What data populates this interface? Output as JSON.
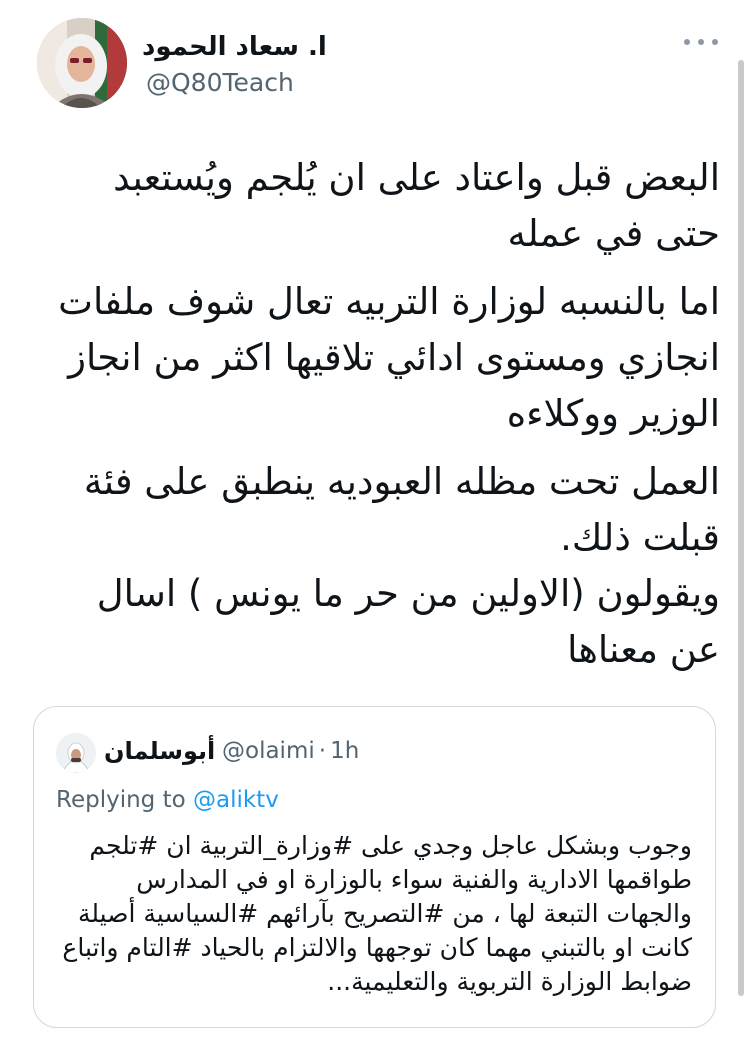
{
  "author": {
    "display_name": "ا. سعاد الحمود",
    "handle": "@Q80Teach"
  },
  "more_icon": "more-horizontal-icon",
  "tweet": {
    "paragraphs": [
      "البعض قبل واعتاد على ان يُلجم ويُستعبد حتى في عمله",
      "اما بالنسبه لوزارة التربيه تعال شوف ملفات انجازي ومستوى ادائي تلاقيها اكثر من انجاز الوزير ووكلاءه",
      "العمل تحت مظله العبوديه ينطبق على فئة قبلت ذلك.",
      "ويقولون (الاولين من حر ما يونس ) اسال عن معناها"
    ]
  },
  "quote": {
    "display_name": "أبوسلمان",
    "handle": "@olaimi",
    "separator": "·",
    "time": "1h",
    "replying_prefix": "Replying to",
    "replying_mention": "@aliktv",
    "text": "وجوب وبشكل عاجل وجدي على #وزارة_التربية ان #تلجم طواقمها الادارية والفنية سواء بالوزارة او في المدارس والجهات التبعة لها ، من #التصريح بآرائهم #السياسية أصيلة كانت او بالتبني مهما كان توجهها والالتزام بالحياد #التام واتباع ضوابط الوزارة التربوية والتعليمية..."
  },
  "colors": {
    "text": "#0f1419",
    "secondary": "#536471",
    "accent": "#1d9bf0",
    "border": "#cfd9de"
  }
}
